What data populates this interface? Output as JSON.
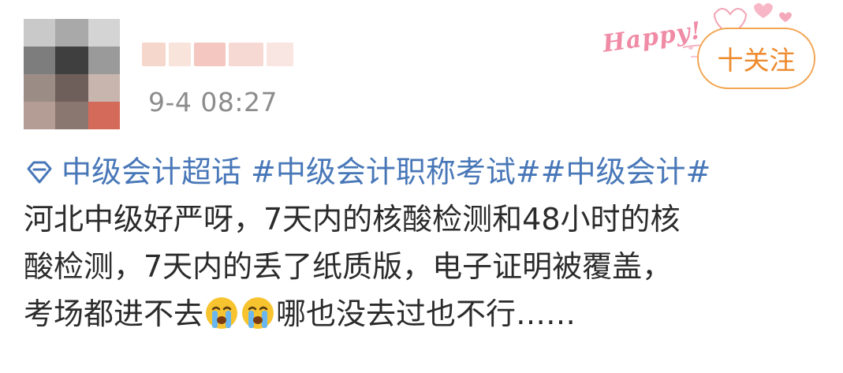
{
  "post": {
    "author": {
      "username": "",
      "avatar_icon": "blurred-avatar"
    },
    "timestamp": "9-4 08:27",
    "sticker_text": "Happy!",
    "follow_label": "十关注",
    "topics": {
      "supertopic": "中级会计超话",
      "tag1": "#中级会计职称考试#",
      "tag2": "#中级会计#"
    },
    "body": {
      "line1": "河北中级好严呀，7天内的核酸检测和48小时的核",
      "line2": "酸检测，7天内的丢了纸质版，电子证明被覆盖，",
      "line3_a": "考场都进不去",
      "line3_b": "哪也没去过也不行……"
    },
    "emoji_icons": [
      "crying-face-icon",
      "crying-face-icon"
    ]
  },
  "colors": {
    "topic_link": "#4877b8",
    "follow_accent": "#ee8a2c",
    "timestamp": "#8c8c8c"
  }
}
